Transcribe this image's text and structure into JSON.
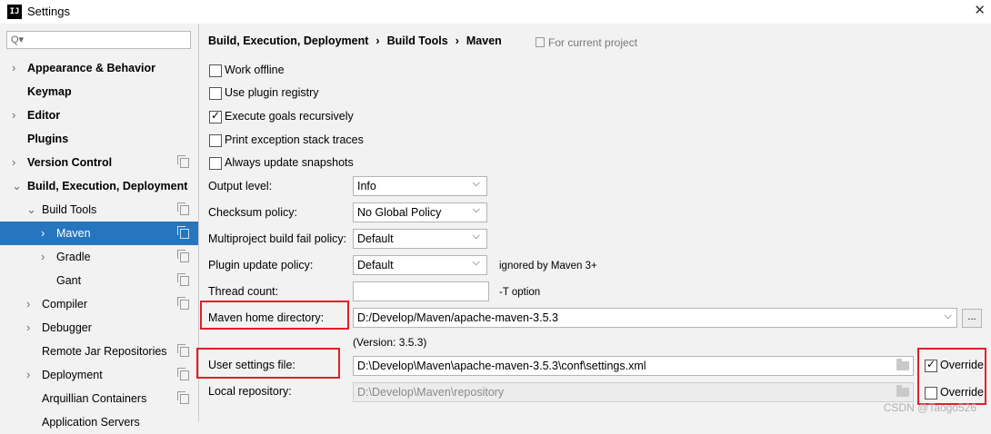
{
  "window": {
    "title": "Settings",
    "close_glyph": "✕",
    "app_icon_text": "IJ"
  },
  "sidebar": {
    "search": {
      "placeholder": "Q▾"
    },
    "items": [
      {
        "label": "Appearance & Behavior",
        "bold": true,
        "expand": "collapsed",
        "copy": false,
        "selected": false
      },
      {
        "label": "Keymap",
        "bold": true,
        "expand": "none",
        "copy": false,
        "selected": false
      },
      {
        "label": "Editor",
        "bold": true,
        "expand": "collapsed",
        "copy": false,
        "selected": false
      },
      {
        "label": "Plugins",
        "bold": true,
        "expand": "none",
        "copy": false,
        "selected": false
      },
      {
        "label": "Version Control",
        "bold": true,
        "expand": "collapsed",
        "copy": true,
        "selected": false
      },
      {
        "label": "Build, Execution, Deployment",
        "bold": true,
        "expand": "expanded",
        "copy": false,
        "selected": false
      },
      {
        "label": "Build Tools",
        "bold": false,
        "expand": "expanded",
        "copy": true,
        "selected": false
      },
      {
        "label": "Maven",
        "bold": false,
        "expand": "collapsed",
        "copy": true,
        "selected": true
      },
      {
        "label": "Gradle",
        "bold": false,
        "expand": "collapsed",
        "copy": true,
        "selected": false
      },
      {
        "label": "Gant",
        "bold": false,
        "expand": "none",
        "copy": true,
        "selected": false
      },
      {
        "label": "Compiler",
        "bold": false,
        "expand": "collapsed",
        "copy": true,
        "selected": false
      },
      {
        "label": "Debugger",
        "bold": false,
        "expand": "collapsed",
        "copy": false,
        "selected": false
      },
      {
        "label": "Remote Jar Repositories",
        "bold": false,
        "expand": "none",
        "copy": true,
        "selected": false
      },
      {
        "label": "Deployment",
        "bold": false,
        "expand": "collapsed",
        "copy": true,
        "selected": false
      },
      {
        "label": "Arquillian Containers",
        "bold": false,
        "expand": "none",
        "copy": true,
        "selected": false
      },
      {
        "label": "Application Servers",
        "bold": false,
        "expand": "none",
        "copy": false,
        "selected": false
      }
    ]
  },
  "breadcrumb": {
    "parts": [
      "Build, Execution, Deployment",
      "Build Tools",
      "Maven"
    ],
    "separator": "›",
    "scope": "For current project"
  },
  "checkboxes": [
    {
      "label": "Work offline",
      "checked": false
    },
    {
      "label": "Use plugin registry",
      "checked": false
    },
    {
      "label": "Execute goals recursively",
      "checked": true
    },
    {
      "label": "Print exception stack traces",
      "checked": false
    },
    {
      "label": "Always update snapshots",
      "checked": false
    }
  ],
  "selects": [
    {
      "label": "Output level:",
      "value": "Info",
      "hint": ""
    },
    {
      "label": "Checksum policy:",
      "value": "No Global Policy",
      "hint": ""
    },
    {
      "label": "Multiproject build fail policy:",
      "value": "Default",
      "hint": ""
    },
    {
      "label": "Plugin update policy:",
      "value": "Default",
      "hint": "ignored by Maven 3+"
    }
  ],
  "thread_count": {
    "label": "Thread count:",
    "value": "",
    "hint": "-T option"
  },
  "maven_home": {
    "label": "Maven home directory:",
    "value": "D:/Develop/Maven/apache-maven-3.5.3",
    "browse": "...",
    "version": "(Version: 3.5.3)"
  },
  "user_settings": {
    "label": "User settings file:",
    "value": "D:\\Develop\\Maven\\apache-maven-3.5.3\\conf\\settings.xml",
    "override_label": "Override",
    "override_checked": true
  },
  "local_repo": {
    "label": "Local repository:",
    "value": "D:\\Develop\\Maven\\repository",
    "override_label": "Override",
    "override_checked": false
  },
  "watermark": "CSDN @Taogo526",
  "colors": {
    "selection": "#2675bf",
    "highlight_box": "#e0202a"
  }
}
